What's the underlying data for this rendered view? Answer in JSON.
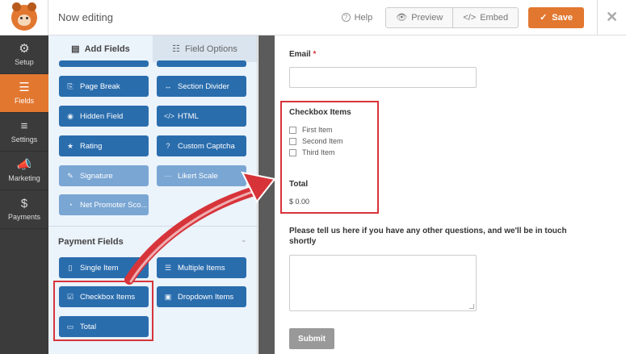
{
  "topbar": {
    "status": "Now editing",
    "help": "Help",
    "preview": "Preview",
    "embed": "Embed",
    "save": "Save"
  },
  "leftnav": {
    "items": [
      {
        "label": "Setup",
        "glyph": "⚙",
        "icon": "gear-icon"
      },
      {
        "label": "Fields",
        "glyph": "☰",
        "icon": "fields-icon"
      },
      {
        "label": "Settings",
        "glyph": "≡",
        "icon": "sliders-icon"
      },
      {
        "label": "Marketing",
        "glyph": "📣",
        "icon": "megaphone-icon"
      },
      {
        "label": "Payments",
        "glyph": "$",
        "icon": "dollar-icon"
      }
    ]
  },
  "panel": {
    "tabs": {
      "add": "Add Fields",
      "options": "Field Options"
    },
    "fields": {
      "page_break": "Page Break",
      "section_divider": "Section Divider",
      "hidden_field": "Hidden Field",
      "html": "HTML",
      "rating": "Rating",
      "custom_captcha": "Custom Captcha",
      "signature": "Signature",
      "likert_scale": "Likert Scale",
      "net_promoter": "Net Promoter Sco..."
    },
    "payment_section": "Payment Fields",
    "payment_fields": {
      "single_item": "Single Item",
      "multiple_items": "Multiple Items",
      "checkbox_items": "Checkbox Items",
      "dropdown_items": "Dropdown Items",
      "total": "Total"
    }
  },
  "form": {
    "email_label": "Email",
    "required_mark": "*",
    "checkbox_label": "Checkbox Items",
    "checkbox_options": [
      "First Item",
      "Second Item",
      "Third Item"
    ],
    "total_label": "Total",
    "total_value": "$ 0.00",
    "message_label": "Please tell us here if you have any other questions, and we'll be in touch shortly",
    "submit": "Submit"
  },
  "colors": {
    "accent": "#e27730",
    "field_button": "#2a6dad",
    "highlight": "#d7343a"
  }
}
